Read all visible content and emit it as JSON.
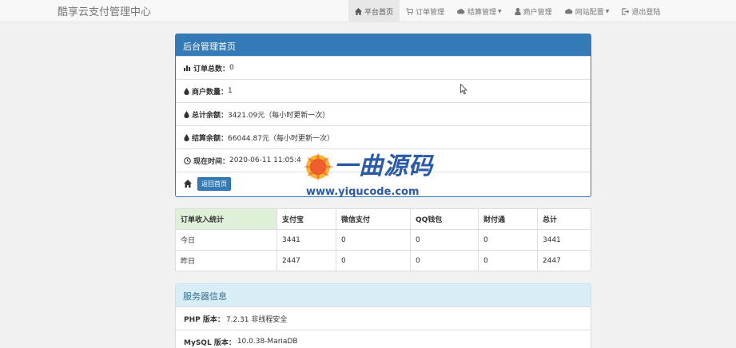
{
  "nav": {
    "brand": "酷享云支付管理中心",
    "items": [
      {
        "label": "平台首页"
      },
      {
        "label": "订单管理"
      },
      {
        "label": "结算管理"
      },
      {
        "label": "商户管理"
      },
      {
        "label": "网站配置"
      },
      {
        "label": "退出登陆"
      }
    ]
  },
  "summary": {
    "title": "后台管理首页",
    "rows": [
      {
        "label": "订单总数：",
        "value": "0"
      },
      {
        "label": "商户数量：",
        "value": "1"
      },
      {
        "label": "总计余额：",
        "value": "3421.09元（每小时更新一次）"
      },
      {
        "label": "结算余额：",
        "value": "66044.87元（每小时更新一次）"
      },
      {
        "label": "现在时间：",
        "value": "2020-06-11 11:05:4"
      }
    ],
    "back_button": "返回首页"
  },
  "stats_table": {
    "headers": [
      "订单收入统计",
      "支付宝",
      "微信支付",
      "QQ钱包",
      "财付通",
      "总计"
    ],
    "rows": [
      [
        "今日",
        "3441",
        "0",
        "0",
        "0",
        "3441"
      ],
      [
        "昨日",
        "2447",
        "0",
        "0",
        "0",
        "2447"
      ]
    ]
  },
  "server": {
    "title": "服务器信息",
    "rows": [
      {
        "label": "PHP 版本：",
        "value": "7.2.31 非线程安全"
      },
      {
        "label": "MySQL 版本：",
        "value": "10.0.38-MariaDB"
      }
    ]
  },
  "watermark": {
    "title": "一曲源码",
    "url": "www.yiqucode.com"
  }
}
